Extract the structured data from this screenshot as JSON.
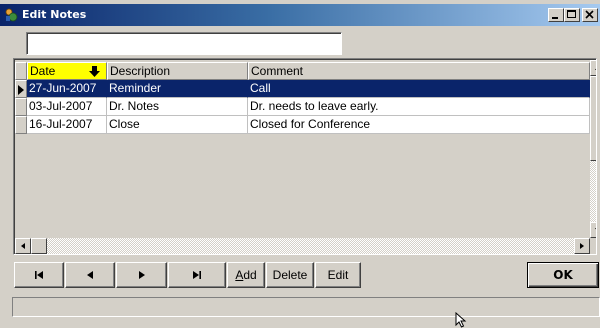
{
  "window": {
    "title": "Edit Notes",
    "app_icon": "notes-app-icon",
    "controls": [
      "minimize-icon",
      "maximize-icon",
      "close-icon"
    ]
  },
  "filter": {
    "value": "",
    "placeholder": ""
  },
  "grid": {
    "columns": [
      {
        "label": "Date",
        "sorted": "descending",
        "highlight_color": "#ffff00"
      },
      {
        "label": "Description"
      },
      {
        "label": "Comment"
      }
    ],
    "rows": [
      {
        "date": "27-Jun-2007",
        "description": "Reminder",
        "comment": "Call",
        "selected": true,
        "current": true
      },
      {
        "date": "03-Jul-2007",
        "description": "Dr. Notes",
        "comment": "Dr. needs to leave early.",
        "selected": false,
        "current": false
      },
      {
        "date": "16-Jul-2007",
        "description": "Close",
        "comment": "Closed for Conference",
        "selected": false,
        "current": false
      }
    ],
    "selection_color": "#0a246a"
  },
  "navigation": {
    "first_icon": "first-record-icon",
    "prev_icon": "previous-record-icon",
    "next_icon": "next-record-icon",
    "last_icon": "last-record-icon",
    "add_label": "Add",
    "add_mnemonic": "A",
    "add_rest": "dd",
    "delete_label": "Delete",
    "edit_label": "Edit"
  },
  "ok_label": "OK",
  "status": ""
}
